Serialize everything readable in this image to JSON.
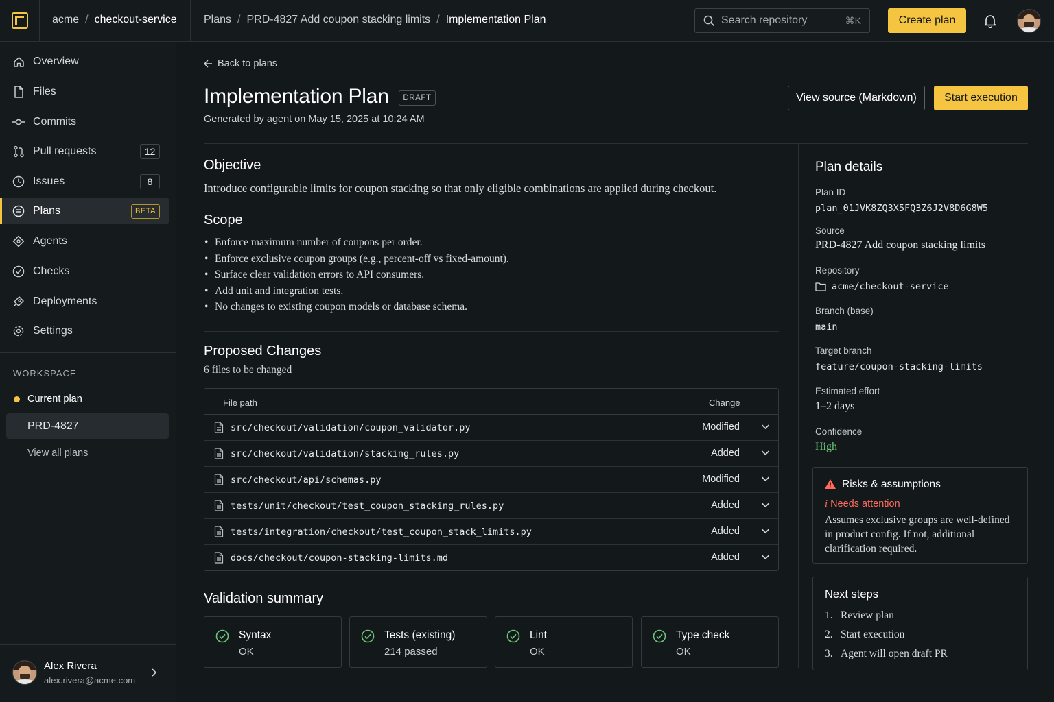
{
  "topbar": {
    "org": "acme",
    "repo": "checkout-service",
    "breadcrumbs": [
      "Plans",
      "PRD-4827 Add coupon stacking limits",
      "Implementation Plan"
    ],
    "search_placeholder": "Search repository",
    "search_shortcut": "⌘K",
    "create_label": "Create plan"
  },
  "sidebar": {
    "items": [
      {
        "label": "Overview",
        "icon": "home-icon"
      },
      {
        "label": "Files",
        "icon": "file-icon"
      },
      {
        "label": "Commits",
        "icon": "commit-icon"
      },
      {
        "label": "Pull requests",
        "icon": "pull-request-icon",
        "count": "12"
      },
      {
        "label": "Issues",
        "icon": "issue-icon",
        "count": "8"
      },
      {
        "label": "Plans",
        "icon": "plans-icon",
        "badge": "BETA",
        "active": true
      },
      {
        "label": "Agents",
        "icon": "agent-icon"
      },
      {
        "label": "Checks",
        "icon": "check-circle-icon"
      },
      {
        "label": "Deployments",
        "icon": "rocket-icon"
      },
      {
        "label": "Settings",
        "icon": "gear-icon"
      }
    ],
    "workspace": {
      "title": "WORKSPACE",
      "current_label": "Current plan",
      "current_plan": "PRD-4827",
      "view_all": "View all plans"
    },
    "user": {
      "name": "Alex Rivera",
      "email": "alex.rivera@acme.com"
    }
  },
  "main": {
    "back_label": "Back to plans",
    "title": "Implementation Plan",
    "status_badge": "DRAFT",
    "generated": "Generated by agent on May 15, 2025 at 10:24 AM",
    "view_source_label": "View source (Markdown)",
    "start_label": "Start execution",
    "objective": {
      "heading": "Objective",
      "text": "Introduce configurable limits for coupon stacking so that only eligible combinations are applied during checkout."
    },
    "scope": {
      "heading": "Scope",
      "items": [
        "Enforce maximum number of coupons per order.",
        "Enforce exclusive coupon groups (e.g., percent-off vs fixed-amount).",
        "Surface clear validation errors to API consumers.",
        "Add unit and integration tests.",
        "No changes to existing coupon models or database schema."
      ]
    },
    "changes": {
      "heading": "Proposed Changes",
      "subtitle": "6 files to be changed",
      "col_path": "File path",
      "col_change": "Change",
      "rows": [
        {
          "path": "src/checkout/validation/coupon_validator.py",
          "change": "Modified"
        },
        {
          "path": "src/checkout/validation/stacking_rules.py",
          "change": "Added"
        },
        {
          "path": "src/checkout/api/schemas.py",
          "change": "Modified"
        },
        {
          "path": "tests/unit/checkout/test_coupon_stacking_rules.py",
          "change": "Added"
        },
        {
          "path": "tests/integration/checkout/test_coupon_stack_limits.py",
          "change": "Added"
        },
        {
          "path": "docs/checkout/coupon-stacking-limits.md",
          "change": "Added"
        }
      ]
    },
    "validation": {
      "heading": "Validation summary",
      "items": [
        {
          "label": "Syntax",
          "value": "OK"
        },
        {
          "label": "Tests (existing)",
          "value": "214 passed"
        },
        {
          "label": "Lint",
          "value": "OK"
        },
        {
          "label": "Type check",
          "value": "OK"
        }
      ]
    }
  },
  "details": {
    "title": "Plan details",
    "plan_id_label": "Plan ID",
    "plan_id": "plan_01JVK8ZQ3X5FQ3Z6J2V8D6G8W5",
    "source_label": "Source",
    "source": "PRD-4827 Add coupon stacking limits",
    "repo_label": "Repository",
    "repo": "acme/checkout-service",
    "branch_label": "Branch (base)",
    "branch": "main",
    "target_label": "Target branch",
    "target": "feature/coupon-stacking-limits",
    "effort_label": "Estimated effort",
    "effort": "1–2 days",
    "confidence_label": "Confidence",
    "confidence": "High",
    "risks": {
      "title": "Risks & assumptions",
      "status": "Needs attention",
      "body": "Assumes exclusive groups are well-defined in product config. If not, additional clarification required."
    },
    "next_steps": {
      "title": "Next steps",
      "items": [
        "Review plan",
        "Start execution",
        "Agent will open draft PR"
      ]
    }
  },
  "colors": {
    "accent": "#f5c542",
    "success": "#6cc77a",
    "danger": "#ff6a5c",
    "background": "#13181b"
  }
}
